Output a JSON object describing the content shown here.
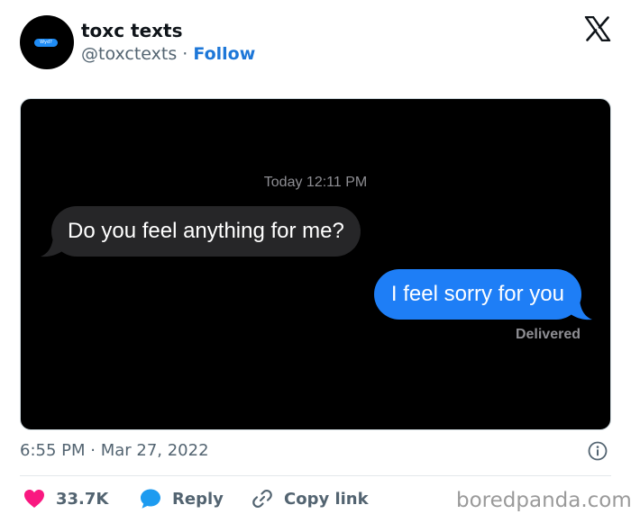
{
  "author": {
    "avatar_text": "Wyd?",
    "name": "toxc texts",
    "handle": "@toxctexts",
    "separator": "·",
    "follow_label": "Follow"
  },
  "platform_icon": "x-logo-icon",
  "conversation": {
    "timestamp": "Today 12:11 PM",
    "incoming_message": "Do you feel anything for me?",
    "outgoing_message": "I feel sorry for you",
    "status": "Delivered",
    "incoming_color": "#262628",
    "outgoing_color": "#1e7ef6"
  },
  "post_time": "6:55 PM · Mar 27, 2022",
  "actions": {
    "like_count": "33.7K",
    "reply_label": "Reply",
    "copy_link_label": "Copy link"
  },
  "icons": {
    "like": "heart-icon",
    "reply": "speech-bubble-icon",
    "copy": "link-icon",
    "info": "info-icon"
  },
  "colors": {
    "heart": "#f91880",
    "reply": "#1d9bf0",
    "follow": "#1d77d8"
  },
  "watermark": "boredpanda.com"
}
